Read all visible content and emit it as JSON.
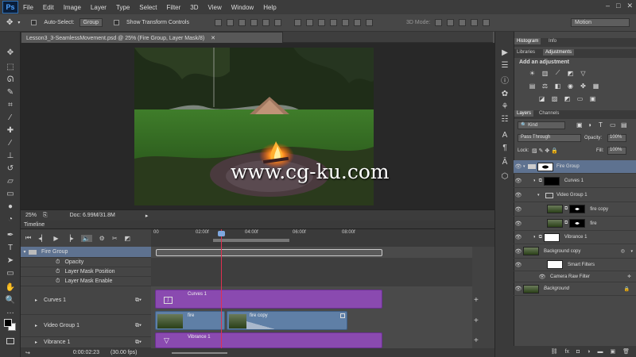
{
  "app": {
    "logo": "Ps"
  },
  "menu": [
    "File",
    "Edit",
    "Image",
    "Layer",
    "Type",
    "Select",
    "Filter",
    "3D",
    "View",
    "Window",
    "Help"
  ],
  "window_controls": [
    "–",
    "□",
    "✕"
  ],
  "options_bar": {
    "auto_select_label": "Auto-Select:",
    "auto_select_value": "Group",
    "show_transform_label": "Show Transform Controls",
    "mode_3d_label": "3D Mode:",
    "workspace": "Motion"
  },
  "document": {
    "tab_title": "Lesson3_3-SeamlessMovement.psd @ 25% (Fire Group, Layer Mask/8)",
    "zoom": "25%",
    "doc_size": "Doc: 6.99M/31.8M"
  },
  "watermark": "www.cg-ku.com",
  "timeline": {
    "title": "Timeline",
    "ruler_labels": [
      "00",
      "02:00f",
      "04:00f",
      "06:00f",
      "08:00f"
    ],
    "rows": [
      {
        "label": "Fire Group",
        "kind": "group"
      },
      {
        "label": "Opacity",
        "kind": "prop"
      },
      {
        "label": "Layer Mask Position",
        "kind": "prop"
      },
      {
        "label": "Layer Mask Enable",
        "kind": "prop"
      },
      {
        "label": "Curves 1",
        "kind": "track"
      },
      {
        "label": "Video Group 1",
        "kind": "track"
      },
      {
        "label": "Vibrance 1",
        "kind": "track"
      }
    ],
    "clips": {
      "curves": "Curves 1",
      "fire": "fire",
      "fire_copy": "fire copy",
      "vibrance": "Vibrance 1"
    },
    "timecode": "0:00:02:23",
    "fps": "(30.00 fps)"
  },
  "right_panel": {
    "tabs_top": [
      "Histogram",
      "Info"
    ],
    "tabs_adj": [
      "Libraries",
      "Adjustments"
    ],
    "add_adjustment": "Add an adjustment",
    "tabs_layers": [
      "Layers",
      "Channels"
    ],
    "filter_kind": "Kind",
    "blend_mode": "Pass Through",
    "opacity_label": "Opacity:",
    "opacity_value": "100%",
    "lock_label": "Lock:",
    "fill_label": "Fill:",
    "fill_value": "100%",
    "layers": [
      {
        "name": "Fire Group",
        "selected": true
      },
      {
        "name": "Curves 1"
      },
      {
        "name": "Video Group 1"
      },
      {
        "name": "fire copy"
      },
      {
        "name": "fire"
      },
      {
        "name": "Vibrance 1"
      },
      {
        "name": "Background copy"
      },
      {
        "name": "Smart Filters"
      },
      {
        "name": "Camera Raw Filter"
      },
      {
        "name": "Background"
      }
    ]
  },
  "colors": {
    "accent_blue": "#4fa3ff",
    "clip_purple": "#8a4ab0",
    "clip_blue": "#5f7fa6",
    "playhead": "#e03050",
    "selected_row": "#5e7290"
  }
}
